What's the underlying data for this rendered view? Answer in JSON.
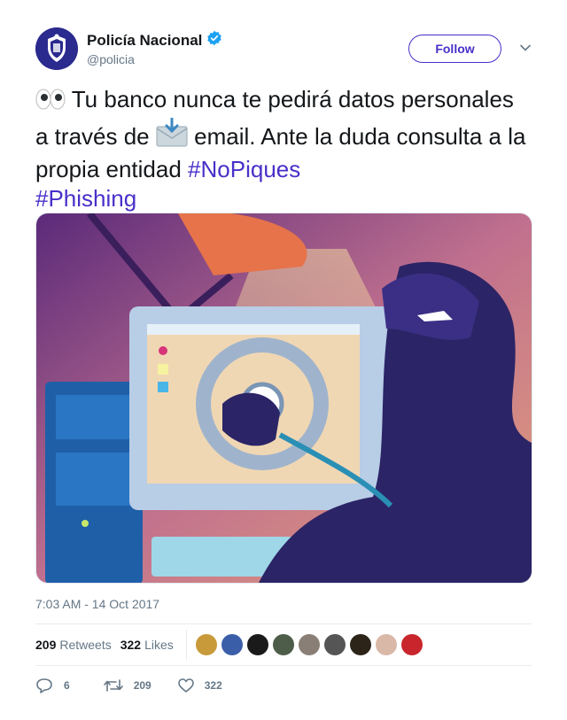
{
  "account": {
    "display_name": "Policía Nacional",
    "handle": "@policia",
    "verified_icon": "verified-badge-icon",
    "follow_label": "Follow"
  },
  "tweet": {
    "text_part1": "Tu banco nunca te pedirá datos personales a través de",
    "text_part2": "email. Ante la duda consulta a la propia entidad",
    "hashtag1": "#NoPiques",
    "hashtag2": "#Phishing",
    "timestamp": "7:03 AM - 14 Oct 2017"
  },
  "stats": {
    "retweets_count": "209",
    "retweets_label": "Retweets",
    "likes_count": "322",
    "likes_label": "Likes"
  },
  "actions": {
    "reply_count": "6",
    "retweet_count": "209",
    "like_count": "322"
  },
  "colors": {
    "accent": "#4a2fc9",
    "muted": "#657786",
    "text": "#14171a"
  }
}
